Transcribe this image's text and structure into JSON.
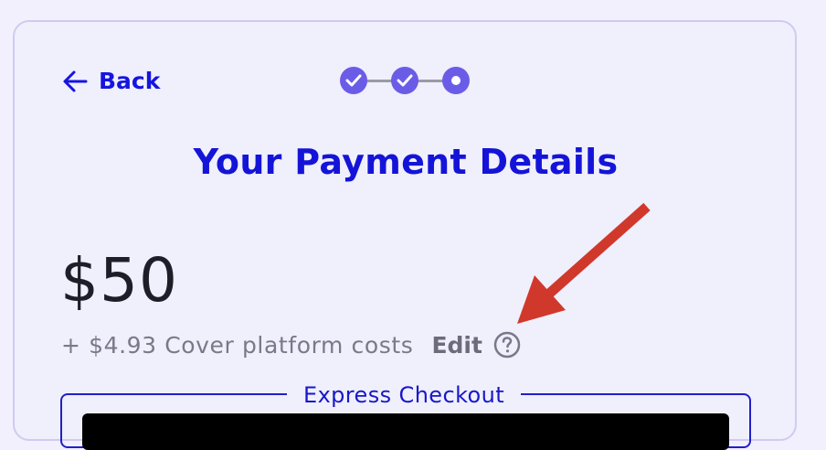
{
  "nav": {
    "back_label": "Back"
  },
  "stepper": {
    "total_steps": 3,
    "current_step": 3,
    "steps": [
      {
        "status": "completed"
      },
      {
        "status": "completed"
      },
      {
        "status": "current"
      }
    ]
  },
  "page": {
    "title": "Your Payment Details"
  },
  "payment": {
    "amount": "$50",
    "fee_text": "+ $4.93 Cover platform costs",
    "edit_label": "Edit",
    "help_icon": "question-circle-icon"
  },
  "express_checkout": {
    "label": "Express Checkout"
  },
  "annotation": {
    "arrow_color": "#d0382b"
  },
  "colors": {
    "accent": "#1414d8",
    "step_fill": "#6b5ce7",
    "background": "#f0effc"
  }
}
